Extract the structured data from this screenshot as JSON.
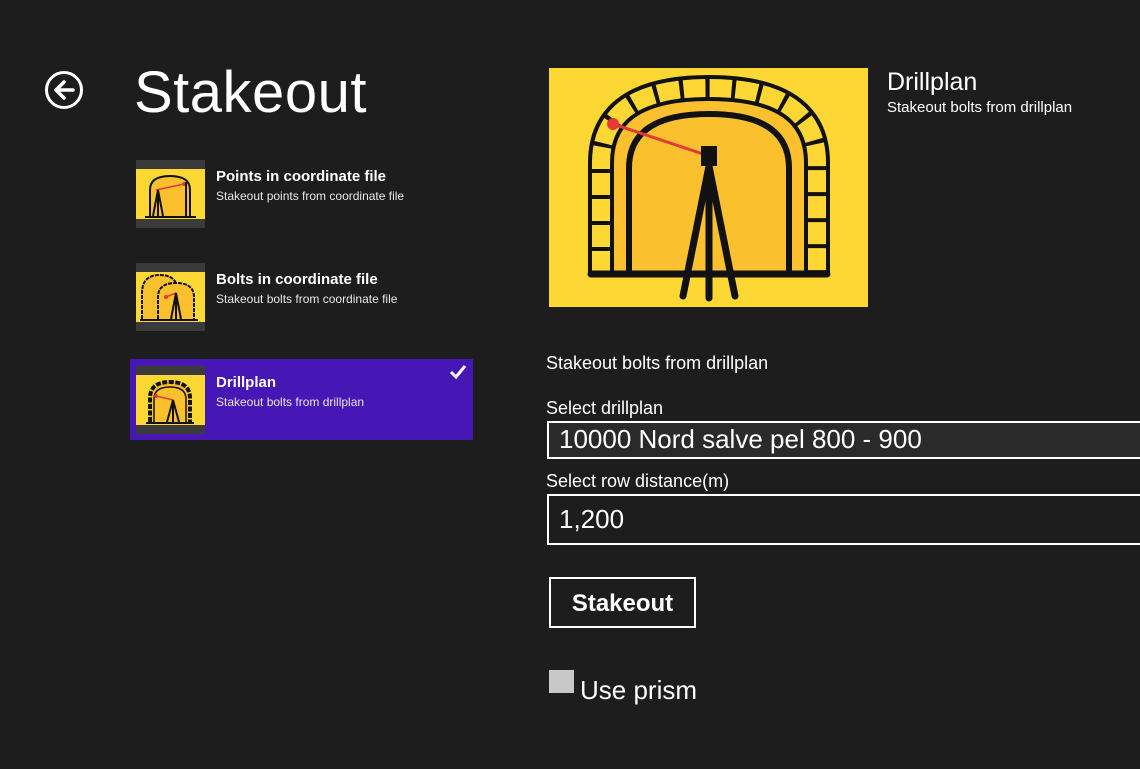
{
  "header": {
    "title": "Stakeout"
  },
  "list": {
    "items": [
      {
        "title": "Points in coordinate file",
        "subtitle": "Stakeout points from coordinate file",
        "selected": false,
        "icon": "tunnel-points-icon"
      },
      {
        "title": "Bolts in coordinate file",
        "subtitle": "Stakeout bolts from coordinate file",
        "selected": false,
        "icon": "tunnel-bolts-icon"
      },
      {
        "title": "Drillplan",
        "subtitle": "Stakeout bolts from drillplan",
        "selected": true,
        "icon": "tunnel-drillplan-icon"
      }
    ]
  },
  "detail": {
    "title": "Drillplan",
    "subtitle": "Stakeout bolts from drillplan",
    "description": "Stakeout bolts from drillplan",
    "drillplan_label": "Select drillplan",
    "drillplan_value": "10000 Nord salve pel 800 - 900",
    "row_distance_label": "Select row distance(m)",
    "row_distance_value": "1,200",
    "stakeout_button": "Stakeout",
    "use_prism_label": "Use prism"
  },
  "colors": {
    "background": "#1d1d1d",
    "accent": "#4617b4",
    "tile": "#fdd835",
    "tunnel": "#fbc02d"
  }
}
